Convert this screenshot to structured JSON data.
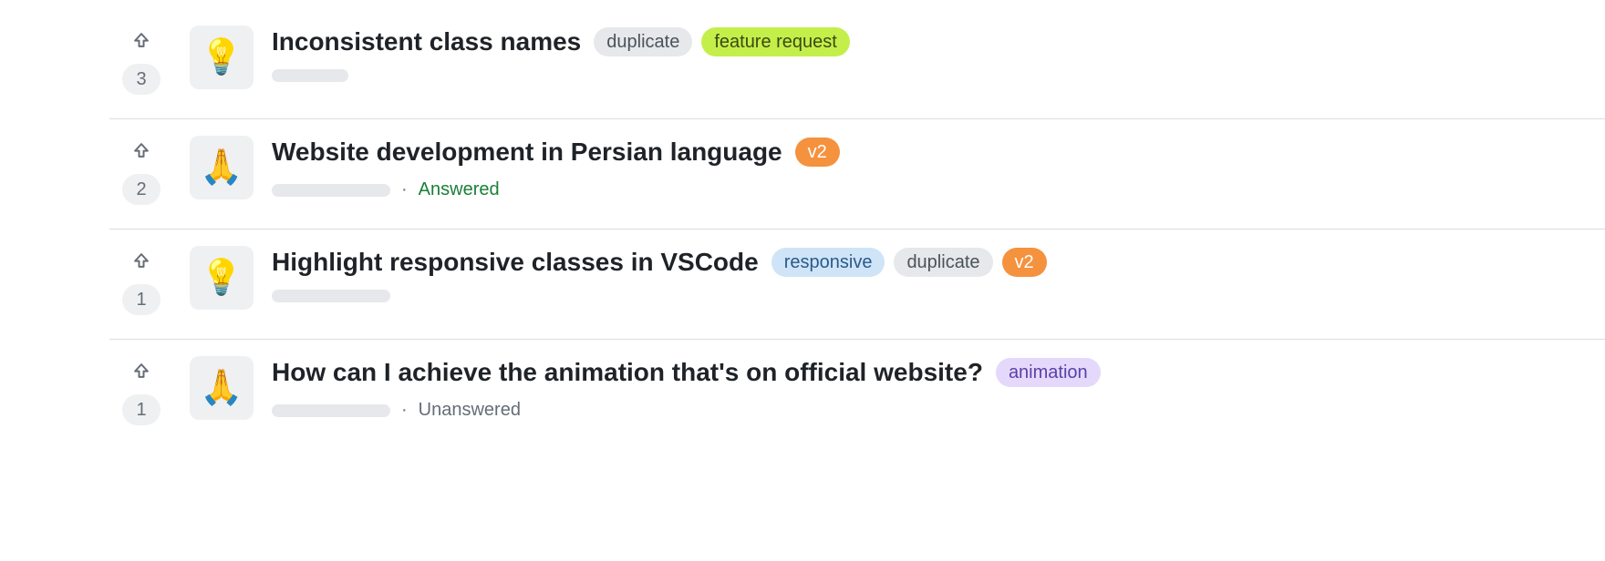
{
  "label_palette": {
    "duplicate": {
      "bg": "#e6e8eb",
      "fg": "#4b535b"
    },
    "feature request": {
      "bg": "#c4ef4a",
      "fg": "#3b4a12"
    },
    "v2": {
      "bg": "#f5923e",
      "fg": "#ffffff"
    },
    "responsive": {
      "bg": "#cfe4f7",
      "fg": "#2a5a8a"
    },
    "animation": {
      "bg": "#e4d9fb",
      "fg": "#5b40a8"
    }
  },
  "discussions": [
    {
      "votes": 3,
      "category_emoji": "💡",
      "title": "Inconsistent class names",
      "labels": [
        "duplicate",
        "feature request"
      ],
      "status": null,
      "skeleton_width": 84
    },
    {
      "votes": 2,
      "category_emoji": "🙏",
      "title": "Website development in Persian language",
      "labels": [
        "v2"
      ],
      "status": "Answered",
      "skeleton_width": 130
    },
    {
      "votes": 1,
      "category_emoji": "💡",
      "title": "Highlight responsive classes in VSCode",
      "labels": [
        "responsive",
        "duplicate",
        "v2"
      ],
      "status": null,
      "skeleton_width": 130
    },
    {
      "votes": 1,
      "category_emoji": "🙏",
      "title": "How can I achieve the animation that's on official website?",
      "labels": [
        "animation"
      ],
      "status": "Unanswered",
      "skeleton_width": 130
    }
  ]
}
